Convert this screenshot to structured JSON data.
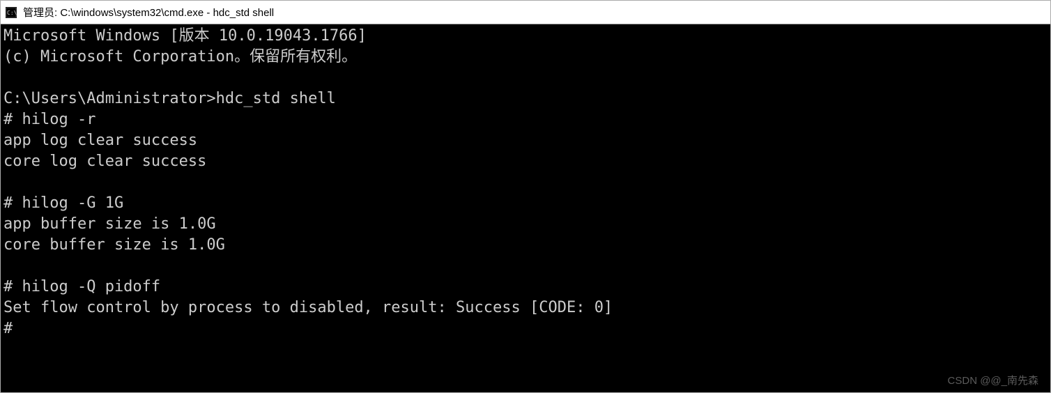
{
  "titlebar": {
    "text": "管理员: C:\\windows\\system32\\cmd.exe - hdc_std  shell"
  },
  "terminal": {
    "lines": [
      "Microsoft Windows [版本 10.0.19043.1766]",
      "(c) Microsoft Corporation。保留所有权利。",
      "",
      "C:\\Users\\Administrator>hdc_std shell",
      "# hilog -r",
      "app log clear success",
      "core log clear success",
      "",
      "# hilog -G 1G",
      "app buffer size is 1.0G",
      "core buffer size is 1.0G",
      "",
      "# hilog -Q pidoff",
      "Set flow control by process to disabled, result: Success [CODE: 0]",
      "#"
    ]
  },
  "watermark": "CSDN @@_南先森"
}
